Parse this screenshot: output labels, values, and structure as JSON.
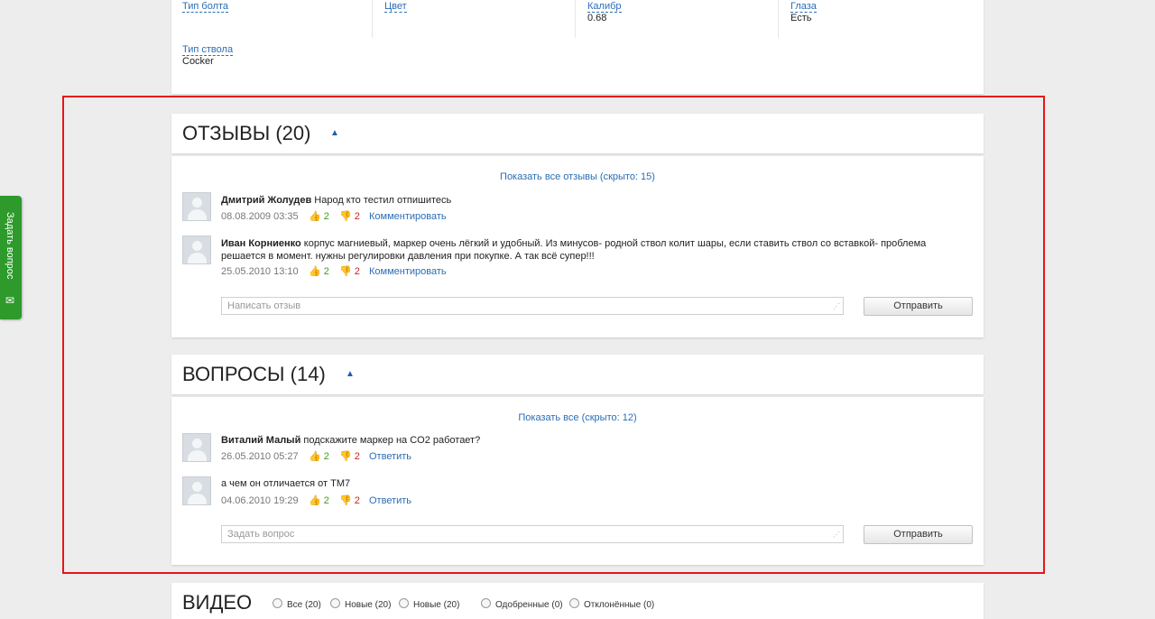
{
  "specs": [
    {
      "label": "Тип болта",
      "value": ""
    },
    {
      "label": "Цвет",
      "value": ""
    },
    {
      "label": "Калибр",
      "value": "0.68"
    },
    {
      "label": "Глаза",
      "value": "Есть"
    },
    {
      "label": "Тип ствола",
      "value": "Cocker"
    }
  ],
  "reviews": {
    "title": "ОТЗЫВЫ (20)",
    "toggle": "▲",
    "show_all": "Показать все отзывы (скрыто: 15)",
    "items": [
      {
        "author": "Дмитрий Жолудев",
        "text": " Народ кто тестил отпишитесь",
        "date": "08.08.2009 03:35",
        "likes": "2",
        "dislikes": "2",
        "action": "Комментировать"
      },
      {
        "author": "Иван Корниенко",
        "text": " корпус магниевый, маркер очень лёгкий и удобный. Из минусов- родной ствол колит шары, если ставить ствол со вставкой- проблема решается в момент. нужны регулировки давления при покупке. А так всё супер!!!",
        "date": "25.05.2010 13:10",
        "likes": "2",
        "dislikes": "2",
        "action": "Комментировать"
      }
    ],
    "input_placeholder": "Написать отзыв",
    "submit": "Отправить"
  },
  "questions": {
    "title": "ВОПРОСЫ (14)",
    "toggle": "▲",
    "show_all": "Показать все (скрыто: 12)",
    "items": [
      {
        "author": "Виталий Малый",
        "text": " подскажите маркер на CO2 работает?",
        "date": "26.05.2010 05:27",
        "likes": "2",
        "dislikes": "2",
        "action": "Ответить"
      },
      {
        "author": "",
        "text": "а чем он отличается от TM7",
        "date": "04.06.2010 19:29",
        "likes": "2",
        "dislikes": "2",
        "action": "Ответить"
      }
    ],
    "input_placeholder": "Задать вопрос",
    "submit": "Отправить"
  },
  "video": {
    "title": "ВИДЕО",
    "filters": [
      "Все (20)",
      "Новые (20)",
      "Новые (20)",
      "Одобренные (0)",
      "Отклонённые (0)"
    ]
  },
  "ask_tab": {
    "label": "Задать вопрос",
    "icon": "mail-icon"
  },
  "colors": {
    "link": "#2a6db6",
    "like": "#3e9e1b",
    "dislike": "#c8251d",
    "highlight": "#e8141a",
    "ask_tab": "#2d9a2b"
  }
}
